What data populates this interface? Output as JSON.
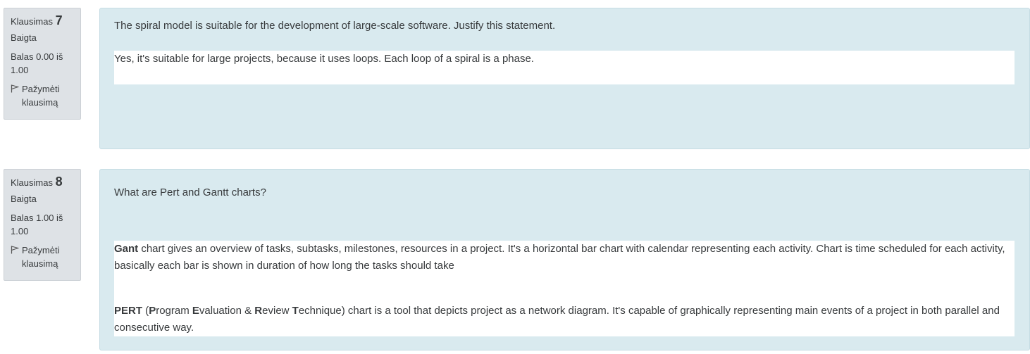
{
  "questions": [
    {
      "number_prefix": "Klausimas",
      "number": "7",
      "status": "Baigta",
      "grade": "Balas 0.00 iš 1.00",
      "flag_label": "Pažymėti klausimą",
      "question_text": "The spiral model is suitable for the development of large-scale software. Justify this statement.",
      "answer_text": "Yes, it's suitable for large projects, because it uses loops. Each loop of a spiral is a phase."
    },
    {
      "number_prefix": "Klausimas",
      "number": "8",
      "status": "Baigta",
      "grade": "Balas 1.00 iš 1.00",
      "flag_label": "Pažymėti klausimą",
      "question_text": "What are Pert and Gantt charts?",
      "answer": {
        "gantt_bold": "Gant",
        "gantt_text": " chart gives an overview of tasks, subtasks, milestones, resources in a project. It's a horizontal bar chart with calendar representing each activity. Chart is time scheduled for each activity, basically each bar is shown in duration of how long the tasks should take",
        "pert_bold": "PERT",
        "pert_open": " (",
        "p_bold": "P",
        "p_rest": "rogram ",
        "e_bold": "E",
        "e_rest": "valuation & ",
        "r_bold": "R",
        "r_rest": "eview ",
        "t_bold": "T",
        "t_rest": "echnique) chart is a tool that depicts project as a network diagram. It's capable of graphically representing main events of a project in both parallel and consecutive way."
      }
    }
  ],
  "icons": {
    "flag": "flag-icon"
  },
  "colors": {
    "info_bg": "#dee2e6",
    "content_bg": "#d9eaef",
    "answer_bg": "#ffffff"
  }
}
